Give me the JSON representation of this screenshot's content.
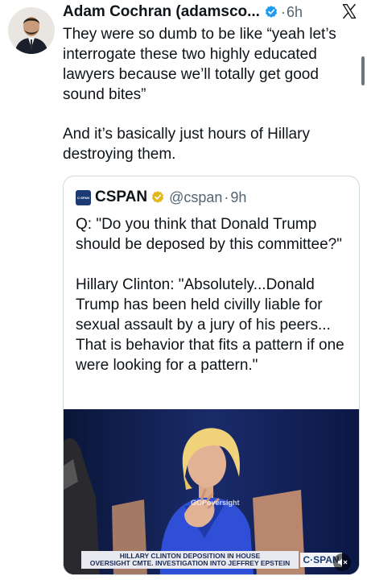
{
  "tweet": {
    "author_name": "Adam Cochran (adamsco...",
    "separator": "·",
    "time": "6h",
    "paragraphs": [
      "They were so dumb to be like “yeah let’s interrogate these two highly educated lawyers because we’ll totally get good sound bites”",
      "And it’s basically just hours of Hillary destroying them."
    ],
    "icons": {
      "avatar": "avatar",
      "verified": "verified-badge-icon",
      "platform": "x-logo-icon"
    },
    "colors": {
      "verified_blue": "#1d9bf0",
      "text": "#0f1419",
      "muted": "#536471",
      "gold": "#e2b719"
    }
  },
  "quote": {
    "logo_text": "C·SPAN",
    "name": "CSPAN",
    "handle": "@cspan",
    "separator": "·",
    "time": "9h",
    "paragraphs": [
      "Q: \"Do you think that Donald Trump should be deposed by this committee?\"",
      "Hillary Clinton: \"Absolutely...Donald Trump has been held civilly liable for sexual assault by a jury of his peers... That is behavior that fits a pattern if one were looking for a pattern.\""
    ],
    "video": {
      "watermark": "GOPoversight",
      "lower_third_line1": "HILLARY CLINTON DEPOSITION IN HOUSE",
      "lower_third_line2": "OVERSIGHT CMTE. INVESTIGATION INTO JEFFREY EPSTEIN",
      "network_bug": "C·SPAN",
      "mute_icon": "mute-icon"
    }
  }
}
